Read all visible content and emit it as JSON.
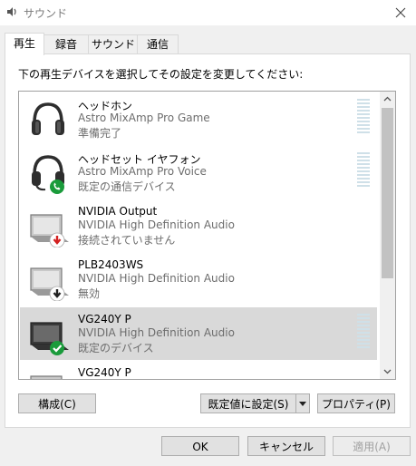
{
  "window": {
    "title": "サウンド"
  },
  "tabs": [
    {
      "label": "再生"
    },
    {
      "label": "録音"
    },
    {
      "label": "サウンド"
    },
    {
      "label": "通信"
    }
  ],
  "panel": {
    "instruction": "下の再生デバイスを選択してその設定を変更してください:"
  },
  "devices": [
    {
      "name": "ヘッドホン",
      "driver": "Astro MixAmp Pro Game",
      "status": "準備完了",
      "icon": "headphones-icon",
      "badge": "none"
    },
    {
      "name": "ヘッドセット イヤフォン",
      "driver": "Astro MixAmp Pro Voice",
      "status": "既定の通信デバイス",
      "icon": "headset-icon",
      "badge": "phone-green"
    },
    {
      "name": "NVIDIA Output",
      "driver": "NVIDIA High Definition Audio",
      "status": "接続されていません",
      "icon": "monitor-icon",
      "badge": "arrow-down-red"
    },
    {
      "name": "PLB2403WS",
      "driver": "NVIDIA High Definition Audio",
      "status": "無効",
      "icon": "monitor-icon",
      "badge": "arrow-down-black"
    },
    {
      "name": "VG240Y P",
      "driver": "NVIDIA High Definition Audio",
      "status": "既定のデバイス",
      "icon": "monitor-icon",
      "badge": "check-green",
      "selected": true
    },
    {
      "name": "VG240Y P",
      "driver": "",
      "status": "",
      "icon": "monitor-icon",
      "badge": "none"
    }
  ],
  "buttons": {
    "configure": "構成(C)",
    "set_default": "既定値に設定(S)",
    "properties": "プロパティ(P)",
    "ok": "OK",
    "cancel": "キャンセル",
    "apply": "適用(A)"
  },
  "colors": {
    "accent_green": "#1a9b3b",
    "error_red": "#d32020",
    "selection": "#d9d9d9"
  }
}
